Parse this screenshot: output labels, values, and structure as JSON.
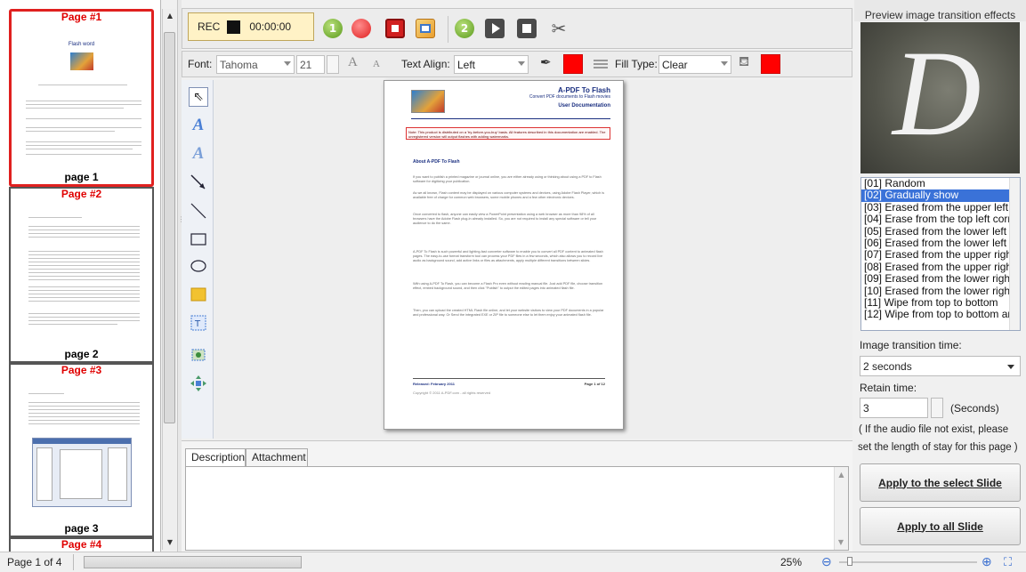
{
  "thumbnails": [
    {
      "title": "Page #1",
      "label": "page 1",
      "selected": true
    },
    {
      "title": "Page #2",
      "label": "page 2",
      "selected": false
    },
    {
      "title": "Page #3",
      "label": "page 3",
      "selected": false
    },
    {
      "title": "Page #4",
      "label": "",
      "selected": false
    }
  ],
  "thumb1_heading": "Flash word",
  "toolbar": {
    "rec_label": "REC",
    "timer": "00:00:00",
    "icons": [
      "step-1-icon",
      "record-icon",
      "stop-record-icon",
      "import-audio-icon",
      "step-2-icon",
      "play-icon",
      "stop-icon",
      "clear-icon"
    ]
  },
  "format": {
    "font_label": "Font:",
    "font_value": "Tahoma",
    "size_value": "21",
    "align_label": "Text Align:",
    "align_value": "Left",
    "fill_label": "Fill Type:",
    "fill_value": "Clear",
    "text_color": "#ff0000",
    "fill_color": "#ff0000"
  },
  "tools": [
    "select-arrow-icon",
    "text-tool-icon",
    "text-outline-tool-icon",
    "arrow-line-tool-icon",
    "line-tool-icon",
    "rectangle-tool-icon",
    "ellipse-tool-icon",
    "filled-rectangle-tool-icon",
    "text-box-tool-icon",
    "image-tool-icon",
    "move-tool-icon"
  ],
  "document": {
    "title": "A-PDF To Flash",
    "subtitle": "Convert PDF documents to Flash movies",
    "subheading": "User Documentation",
    "note": "Note: This product is distributed on a 'try-before-you-buy' basis. All features described in this documentation are enabled. The unregistered version will output flashes with adding watermarks.",
    "section": "About A-PDF To Flash",
    "paragraphs": [
      "If you want to publish a printed magazine or journal online, you are either already using or thinking about using a PDF to Flash software for digitizing your publication.",
      "As we all known, Flash content may be displayed on various computer systems and devices, using Adobe Flash Player, which is available free of charge for common web browsers, some mobile phones and a few other electronic devices.",
      "Once converted to flash, anyone can easily view a PowerPoint presentation using a web browser as more than 98% of all browsers have the Adobe Flash plug-in already installed. So, you are not required to install any special software or tell your audience to do the same.",
      "A-PDF To Flash is such powerful and lighting-fast converter software to enable you to convert all PDF content to animated flash pages. The easy-to-use format transform tool can process your PDF files in a few seconds, which also allows you to record live audio as background sound, add active links or files as attachments, apply multiple different transitions between slides.",
      "With using A-PDF To Flash, you can become a Flash Pro even without reading manual file. Just add PDF file, choose transition effect, embed background sound, and then click \"Publish\" to output the edited pages into animated flash file.",
      "Then, you can upload the created HTML Flash file online, and let your website visitors to view your PDF documents in a popular and professional way. Or Send the integrated EXE or ZIP file to someone else to let them enjoy your animated flash file."
    ],
    "released": "Released: February 2011",
    "page": "Page 1 of 12",
    "copyright": "Copyright © 2011 A-PDF.com - all rights reserved"
  },
  "tabs": [
    "Description",
    "Attachment"
  ],
  "right": {
    "preview_title": "Preview image transition effects",
    "preview_letter": "D",
    "effects": [
      "[01] Random",
      "[02] Gradually show",
      "[03] Erased from the upper left c",
      "[04] Erase from the top left corn",
      "[05] Erased from the lower left c",
      "[06] Erased from the lower left c",
      "[07] Erased from the upper right",
      "[08] Erased from the upper right",
      "[09] Erased from the lower right",
      "[10] Erased from the lower right",
      "[11] Wipe from top to bottom",
      "[12] Wipe from top to bottom an"
    ],
    "selected_effect": 1,
    "transition_label": "Image transition time:",
    "transition_value": "2 seconds",
    "retain_label": "Retain time:",
    "retain_value": "3",
    "seconds_label": "(Seconds)",
    "hint_line1": "( If the audio file not exist, please",
    "hint_line2": "set the length of stay for this page )",
    "apply_select": "Apply to the select Slide",
    "apply_all": "Apply to all Slide"
  },
  "status": {
    "page_info": "Page 1 of 4",
    "zoom": "25%"
  }
}
